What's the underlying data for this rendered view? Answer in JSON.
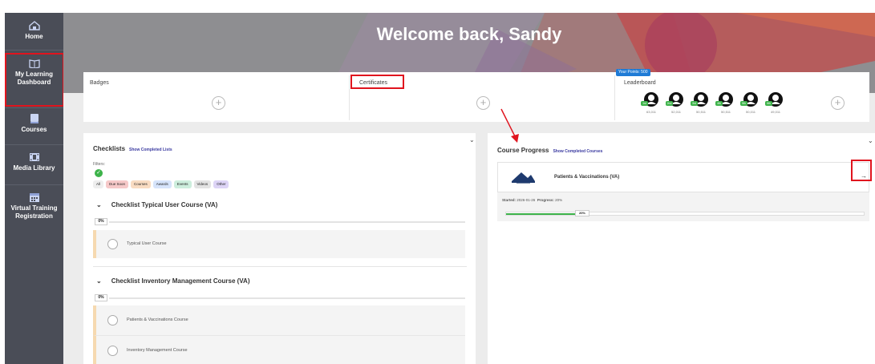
{
  "sidebar": {
    "items": [
      {
        "label": "Home"
      },
      {
        "label": "My Learning Dashboard"
      },
      {
        "label": "Courses"
      },
      {
        "label": "Media Library"
      },
      {
        "label": "Virtual Training Registration"
      }
    ]
  },
  "banner": {
    "title": "Welcome back, Sandy"
  },
  "cards": {
    "badges": {
      "label": "Badges"
    },
    "certificates": {
      "label": "Certificates"
    },
    "leaderboard": {
      "label": "Leaderboard",
      "points_badge": "Your Points: 500",
      "entries": [
        {
          "rank": "1st",
          "score": "63,011"
        },
        {
          "rank": "2nd",
          "score": "52,011"
        },
        {
          "rank": "3rd",
          "score": "50,511"
        },
        {
          "rank": "4th",
          "score": "50,511"
        },
        {
          "rank": "5th",
          "score": "50,011"
        },
        {
          "rank": "6th",
          "score": "49,011"
        }
      ]
    }
  },
  "checklists": {
    "title": "Checklists",
    "show_link": "Show Completed Lists",
    "filters_label": "Filters:",
    "filters": [
      {
        "label": "All",
        "color": "#eeeeee"
      },
      {
        "label": "Due Soon",
        "color": "#f6c9c9"
      },
      {
        "label": "Courses",
        "color": "#f9dcc2"
      },
      {
        "label": "Awards",
        "color": "#d6e4fb"
      },
      {
        "label": "Events",
        "color": "#cdeedd"
      },
      {
        "label": "Videos",
        "color": "#e3e3e3"
      },
      {
        "label": "Other",
        "color": "#ddd4f6"
      }
    ],
    "groups": [
      {
        "title": "Checklist Typical User Course (VA)",
        "progress": "0%",
        "items": [
          "Typical User Course"
        ]
      },
      {
        "title": "Checklist Inventory Management Course (VA)",
        "progress": "0%",
        "items": [
          "Patients & Vaccinations Course",
          "Inventory Management Course"
        ]
      }
    ]
  },
  "course_progress": {
    "title": "Course Progress",
    "show_link": "Show Completed Courses",
    "course": {
      "name": "Patients & Vaccinations (VA)",
      "started_label": "Started:",
      "started_value": "2026-01-26",
      "progress_label": "Progress:",
      "progress_value": "20%",
      "progress_fraction": 0.2,
      "bar_text": "20%"
    }
  },
  "colors": {
    "sidebar": "#4a4d57",
    "annotation_red": "#e0141e",
    "progress_green": "#3db34a",
    "points_blue": "#1f7bd6"
  }
}
